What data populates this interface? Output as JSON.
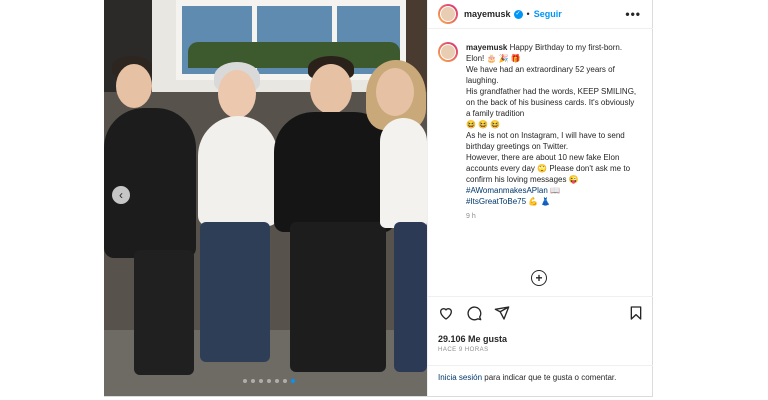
{
  "post": {
    "username": "mayemusk",
    "follow_label": "Seguir",
    "separator": "•",
    "more_icon": "•••",
    "caption_lines": [
      "Happy Birthday to my first-born. Elon! 🎂 🎉 🎁",
      "We have had an extraordinary 52 years of laughing.",
      "His grandfather had the words, KEEP SMILING, on the back of his business cards. It's obviously a family tradition",
      "😆 😆 😆",
      "As he is not on Instagram, I will have to send birthday greetings on Twitter.",
      "However, there are about 10 new fake Elon accounts every day 🙄 Please don't ask me to confirm his loving messages 😜"
    ],
    "hashtags": [
      "#AWomanmakesAPlan 📖",
      "#ItsGreatToBe75 💪 👗"
    ],
    "time": "9 h",
    "likes": "29.106 Me gusta",
    "posted_ago": "HACE 9 HORAS",
    "login_link": "Inicia sesión",
    "login_text": " para indicar que te gusta o comentar.",
    "carousel": {
      "count": 7,
      "active": 6
    },
    "icons": {
      "like": "heart-icon",
      "comment": "comment-icon",
      "share": "share-icon",
      "save": "bookmark-icon",
      "add_comment": "add-comment-icon",
      "verified": "verified-icon"
    },
    "colors": {
      "accent": "#0095f6",
      "hashtag": "#00376b",
      "muted": "#8e8e8e"
    }
  }
}
